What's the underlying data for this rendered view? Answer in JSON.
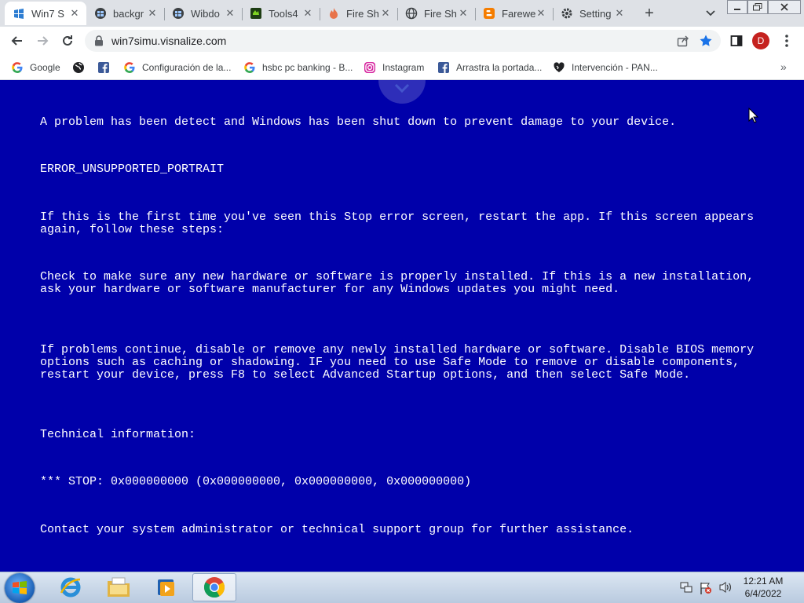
{
  "browser": {
    "tabs": [
      {
        "title": "Win7 S",
        "icon": "win7-favicon",
        "active": true
      },
      {
        "title": "backgr",
        "icon": "win7-favicon",
        "active": false
      },
      {
        "title": "Wibdo",
        "icon": "win7-favicon",
        "active": false
      },
      {
        "title": "Tools4",
        "icon": "tools-favicon",
        "active": false
      },
      {
        "title": "Fire Sh",
        "icon": "flame-favicon",
        "active": false
      },
      {
        "title": "Fire Sh",
        "icon": "globe-favicon",
        "active": false
      },
      {
        "title": "Farewe",
        "icon": "blogger-favicon",
        "active": false
      },
      {
        "title": "Setting",
        "icon": "gear-favicon",
        "active": false
      }
    ],
    "url": "win7simu.visnalize.com",
    "profile_initial": "D",
    "colors": {
      "profile": "#c5221f",
      "star": "#1a73e8",
      "tabstrip": "#dee1e6"
    }
  },
  "bookmarks": [
    {
      "label": "Google",
      "icon": "google-icon"
    },
    {
      "label": "",
      "icon": "globe-icon"
    },
    {
      "label": "",
      "icon": "facebook-icon"
    },
    {
      "label": "Configuración de la...",
      "icon": "google-icon"
    },
    {
      "label": "hsbc pc banking - B...",
      "icon": "google-icon"
    },
    {
      "label": "Instagram",
      "icon": "instagram-icon"
    },
    {
      "label": "Arrastra la portada...",
      "icon": "facebook-icon"
    },
    {
      "label": "Intervención - PAN...",
      "icon": "heart-icon"
    }
  ],
  "bsod": {
    "background": "#0000aa",
    "intro": "A problem has been detect and Windows has been shut down to prevent damage to your device.",
    "error_code": "ERROR_UNSUPPORTED_PORTRAIT",
    "first_time": "If this is the first time you've seen this Stop error screen, restart the app. If this screen appears again, follow these steps:",
    "check": "Check to make sure any new hardware or software is properly installed. If this is a new installation, ask your hardware or software manufacturer for any Windows updates you might need.",
    "problems": "If problems continue, disable or remove any newly installed hardware or software. Disable BIOS memory options such as caching or shadowing. IF you need to use Safe Mode to remove or disable components, restart your device, press F8 to select Advanced Startup options, and then select Safe Mode.",
    "tech_header": "Technical information:",
    "stop": "*** STOP: 0x000000000 (0x000000000, 0x000000000, 0x000000000)",
    "contact": "Contact your system administrator or technical support group for further assistance."
  },
  "taskbar": {
    "items": [
      "internet-explorer-icon",
      "file-explorer-icon",
      "media-player-icon",
      "chrome-icon"
    ],
    "time": "12:21 AM",
    "date": "6/4/2022"
  }
}
